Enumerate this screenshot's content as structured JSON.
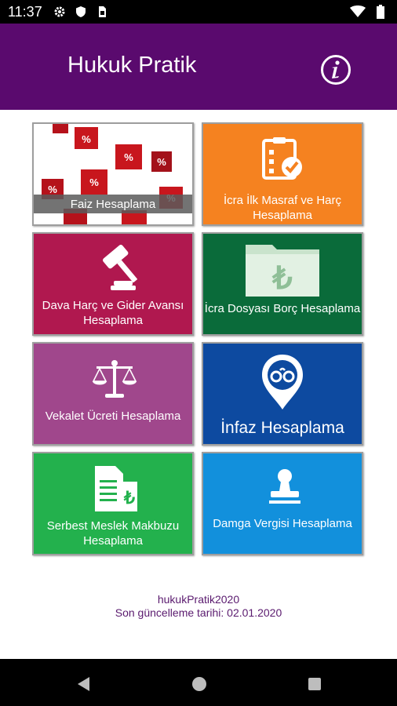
{
  "status_bar": {
    "time": "11:37",
    "left_icons": [
      "gear-icon",
      "shield-icon",
      "sim-card-icon"
    ],
    "right_icons": [
      "wifi-icon",
      "battery-icon"
    ]
  },
  "app_bar": {
    "title": "Hukuk Pratik",
    "action_icon": "info-icon",
    "background": "#5a0a6e"
  },
  "tiles": [
    {
      "id": "faiz",
      "label": "Faiz Hesaplama",
      "color": "#ffffff",
      "icon": "percent-dice-image"
    },
    {
      "id": "icra-ilk-masraf",
      "label": "İcra İlk Masraf ve Harç Hesaplama",
      "color": "#f58220",
      "icon": "clipboard-check-icon"
    },
    {
      "id": "dava-harc",
      "label": "Dava Harç ve Gider Avansı Hesaplama",
      "color": "#b0184f",
      "icon": "gavel-icon"
    },
    {
      "id": "icra-dosyasi",
      "label": "İcra Dosyası Borç Hesaplama",
      "color": "#0a6b3a",
      "icon": "folder-lira-icon"
    },
    {
      "id": "vekalet",
      "label": "Vekalet Ücreti Hesaplama",
      "color": "#a0478c",
      "icon": "scales-icon"
    },
    {
      "id": "infaz",
      "label": "İnfaz Hesaplama",
      "color": "#0d4aa0",
      "icon": "handcuffs-pin-icon"
    },
    {
      "id": "serbest-meslek",
      "label": "Serbest Meslek Makbuzu Hesaplama",
      "color": "#23b14d",
      "icon": "receipt-lira-icon"
    },
    {
      "id": "damga-vergisi",
      "label": "Damga Vergisi Hesaplama",
      "color": "#1290dc",
      "icon": "stamp-icon"
    }
  ],
  "footer": {
    "app_name": "hukukPratik2020",
    "last_update": "Son güncelleme tarihi: 02.01.2020"
  },
  "nav_bar": {
    "buttons": [
      "back-icon",
      "home-icon",
      "recents-icon"
    ]
  }
}
